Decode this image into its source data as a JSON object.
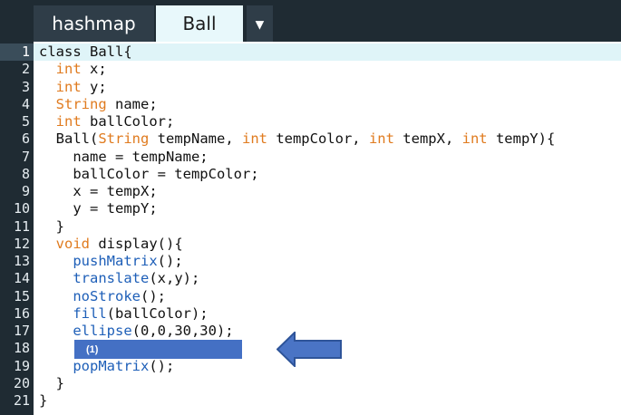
{
  "tabs": [
    {
      "label": "hashmap",
      "active": false
    },
    {
      "label": "Ball",
      "active": true
    }
  ],
  "tab_menu_icon": "▼",
  "code_lines": [
    {
      "num": "1",
      "segments": [
        {
          "t": "class Ball{",
          "c": ""
        }
      ]
    },
    {
      "num": "2",
      "segments": [
        {
          "t": "  ",
          "c": ""
        },
        {
          "t": "int",
          "c": "kw"
        },
        {
          "t": " x;",
          "c": ""
        }
      ]
    },
    {
      "num": "3",
      "segments": [
        {
          "t": "  ",
          "c": ""
        },
        {
          "t": "int",
          "c": "kw"
        },
        {
          "t": " y;",
          "c": ""
        }
      ]
    },
    {
      "num": "4",
      "segments": [
        {
          "t": "  ",
          "c": ""
        },
        {
          "t": "String",
          "c": "kw"
        },
        {
          "t": " name;",
          "c": ""
        }
      ]
    },
    {
      "num": "5",
      "segments": [
        {
          "t": "  ",
          "c": ""
        },
        {
          "t": "int",
          "c": "kw"
        },
        {
          "t": " ballColor;",
          "c": ""
        }
      ]
    },
    {
      "num": "6",
      "segments": [
        {
          "t": "  Ball(",
          "c": ""
        },
        {
          "t": "String",
          "c": "kw"
        },
        {
          "t": " tempName, ",
          "c": ""
        },
        {
          "t": "int",
          "c": "kw"
        },
        {
          "t": " tempColor, ",
          "c": ""
        },
        {
          "t": "int",
          "c": "kw"
        },
        {
          "t": " tempX, ",
          "c": ""
        },
        {
          "t": "int",
          "c": "kw"
        },
        {
          "t": " tempY){",
          "c": ""
        }
      ]
    },
    {
      "num": "7",
      "segments": [
        {
          "t": "    name = tempName;",
          "c": ""
        }
      ]
    },
    {
      "num": "8",
      "segments": [
        {
          "t": "    ballColor = tempColor;",
          "c": ""
        }
      ]
    },
    {
      "num": "9",
      "segments": [
        {
          "t": "    x = tempX;",
          "c": ""
        }
      ]
    },
    {
      "num": "10",
      "segments": [
        {
          "t": "    y = tempY;",
          "c": ""
        }
      ]
    },
    {
      "num": "11",
      "segments": [
        {
          "t": "  }",
          "c": ""
        }
      ]
    },
    {
      "num": "12",
      "segments": [
        {
          "t": "  ",
          "c": ""
        },
        {
          "t": "void",
          "c": "kw"
        },
        {
          "t": " display(){",
          "c": ""
        }
      ]
    },
    {
      "num": "13",
      "segments": [
        {
          "t": "    ",
          "c": ""
        },
        {
          "t": "pushMatrix",
          "c": "fn"
        },
        {
          "t": "();",
          "c": ""
        }
      ]
    },
    {
      "num": "14",
      "segments": [
        {
          "t": "    ",
          "c": ""
        },
        {
          "t": "translate",
          "c": "fn"
        },
        {
          "t": "(x,y);",
          "c": ""
        }
      ]
    },
    {
      "num": "15",
      "segments": [
        {
          "t": "    ",
          "c": ""
        },
        {
          "t": "noStroke",
          "c": "fn"
        },
        {
          "t": "();",
          "c": ""
        }
      ]
    },
    {
      "num": "16",
      "segments": [
        {
          "t": "    ",
          "c": ""
        },
        {
          "t": "fill",
          "c": "fn"
        },
        {
          "t": "(ballColor);",
          "c": ""
        }
      ]
    },
    {
      "num": "17",
      "segments": [
        {
          "t": "    ",
          "c": ""
        },
        {
          "t": "ellipse",
          "c": "fn"
        },
        {
          "t": "(0,0,30,30);",
          "c": ""
        }
      ]
    },
    {
      "num": "18",
      "segments": [
        {
          "t": "",
          "c": ""
        }
      ]
    },
    {
      "num": "19",
      "segments": [
        {
          "t": "    ",
          "c": ""
        },
        {
          "t": "popMatrix",
          "c": "fn"
        },
        {
          "t": "();",
          "c": ""
        }
      ]
    },
    {
      "num": "20",
      "segments": [
        {
          "t": "  }",
          "c": ""
        }
      ]
    },
    {
      "num": "21",
      "segments": [
        {
          "t": "}",
          "c": ""
        }
      ]
    }
  ],
  "current_line": "1",
  "blank_marker": {
    "label": "(1)"
  },
  "colors": {
    "keyword": "#e07b1f",
    "function": "#1e5fb8",
    "marker": "#4470c4"
  }
}
